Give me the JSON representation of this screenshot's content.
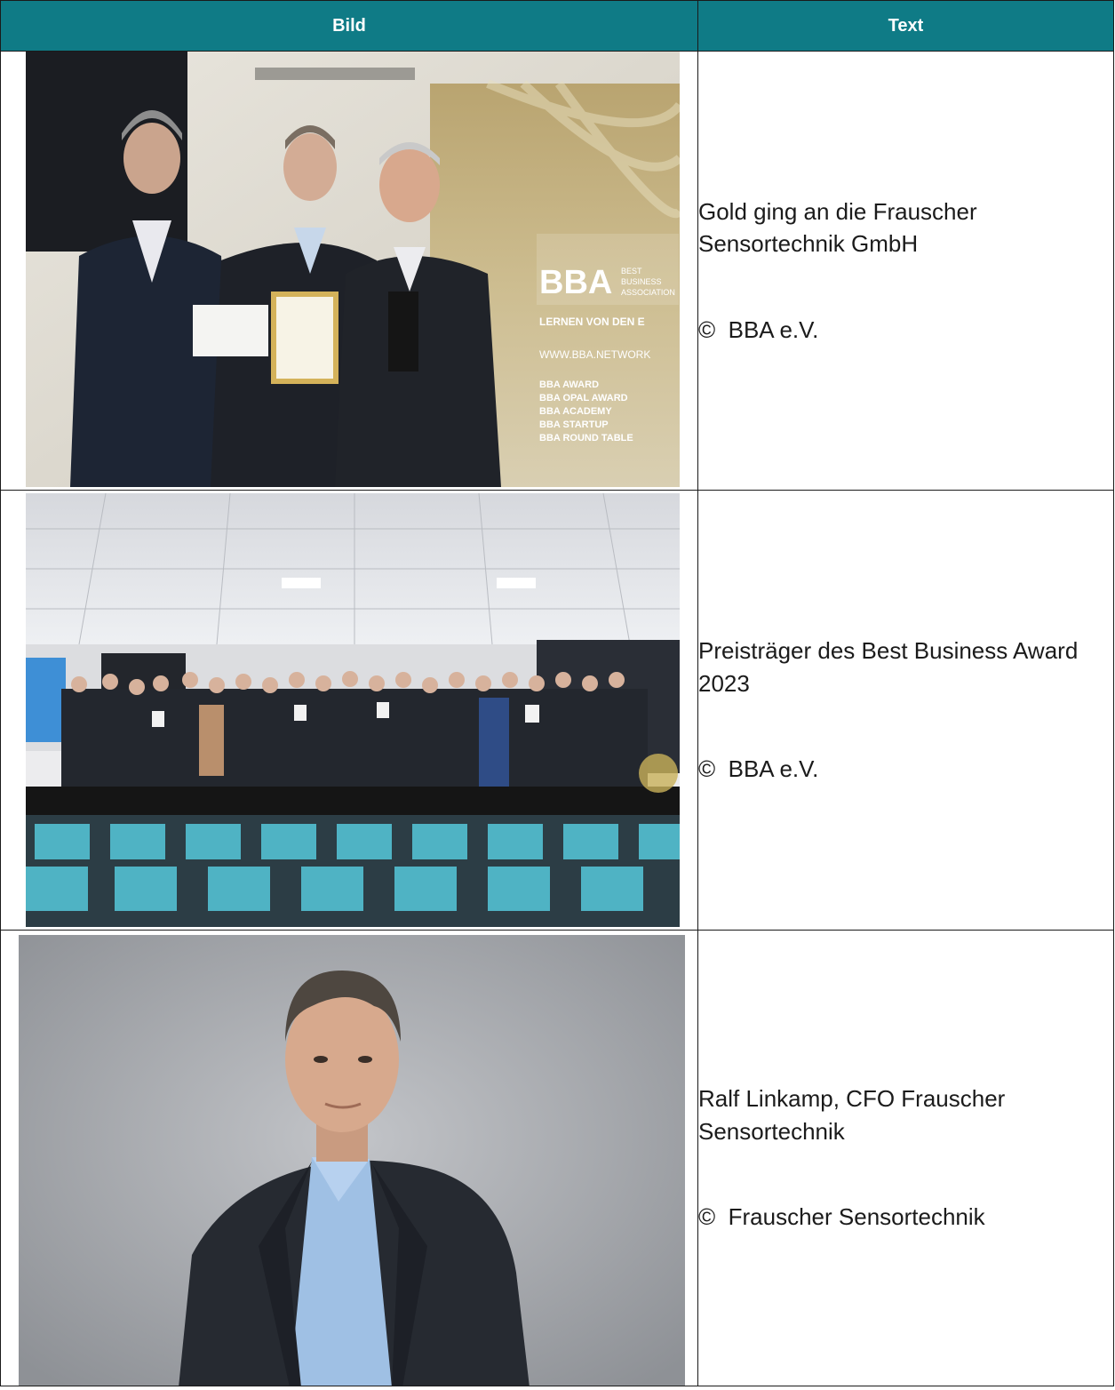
{
  "table": {
    "headers": {
      "image": "Bild",
      "text": "Text"
    },
    "rows": [
      {
        "image_desc": "award-handover-photo",
        "caption": "Gold ging an die Frauscher Sensortechnik GmbH",
        "credit_symbol": "©",
        "credit": "BBA e.V.",
        "photo_text": {
          "logo": "BBA",
          "logo_sub": "BEST BUSINESS ASSOCIATION",
          "tagline": "LERNEN VON DEN E",
          "url": "WWW.BBA.NETWORK",
          "list": [
            "BBA AWARD",
            "BBA OPAL AWARD",
            "BBA ACADEMY",
            "BBA STARTUP",
            "BBA ROUND TABLE"
          ]
        }
      },
      {
        "image_desc": "award-winners-group-photo",
        "caption": "Preisträger des Best Business Award 2023",
        "credit_symbol": "©",
        "credit": "BBA e.V."
      },
      {
        "image_desc": "portrait-photo",
        "caption": "Ralf Linkamp, CFO Frauscher Sensortechnik",
        "credit_symbol": "©",
        "credit": "Frauscher Sensortechnik"
      }
    ]
  }
}
